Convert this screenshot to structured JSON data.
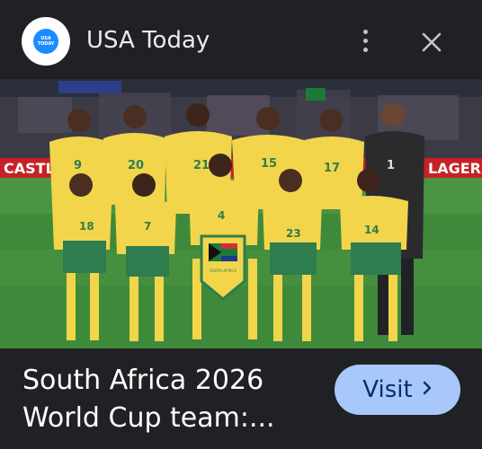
{
  "header": {
    "source_name": "USA Today",
    "logo_text": [
      "USA",
      "TODAY"
    ],
    "more_icon": "more-vert-icon",
    "close_icon": "close-icon"
  },
  "image": {
    "banner_left": "CASTLE",
    "banner_right": "LAGER",
    "pennant_text": "SOUTH AFRICA",
    "lens_icon": "google-lens-icon"
  },
  "footer": {
    "title_line1": "South Africa 2026",
    "title_line2": "World Cup team:...",
    "visit_label": "Visit",
    "visit_icon": "chevron-right-icon"
  },
  "colors": {
    "background": "#202124",
    "visit_button": "#a8c7fa",
    "visit_text": "#062e6f",
    "jersey_yellow": "#f2d54a",
    "shorts_green": "#2e7d4f"
  }
}
